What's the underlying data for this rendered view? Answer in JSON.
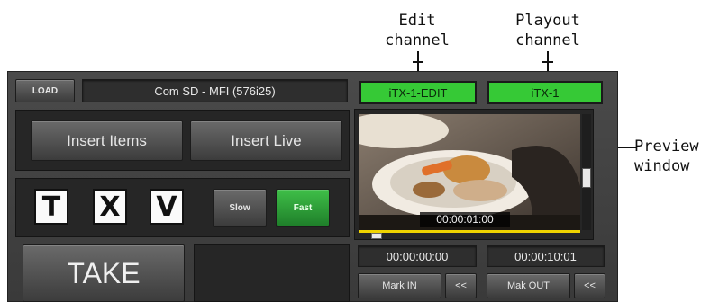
{
  "callouts": {
    "edit_channel": [
      "Edit",
      "channel"
    ],
    "playout_channel": [
      "Playout",
      "channel"
    ],
    "preview_window": [
      "Preview",
      "window"
    ]
  },
  "header": {
    "load_label": "LOAD",
    "format_value": "Com SD - MFI (576i25)",
    "edit_channel_name": "iTX-1-EDIT",
    "playout_channel_name": "iTX-1"
  },
  "insert": {
    "items_label": "Insert Items",
    "live_label": "Insert Live"
  },
  "transitions": {
    "t_label": "T",
    "x_label": "X",
    "v_label": "V",
    "slow_label": "Slow",
    "fast_label": "Fast"
  },
  "take": {
    "label": "TAKE"
  },
  "preview": {
    "timecode": "00:00:01:00",
    "playhead_progress": 0.08
  },
  "marks": {
    "in_timecode": "00:00:00:00",
    "out_timecode": "00:00:10:01",
    "mark_in_label": "Mark IN",
    "mark_in_back_label": "<<",
    "mark_out_label": "Mak OUT",
    "mark_out_back_label": "<<"
  },
  "colors": {
    "channel_active": "#36c936",
    "fast_active": "#2fa33a",
    "scrub_bar": "#f0d400"
  }
}
